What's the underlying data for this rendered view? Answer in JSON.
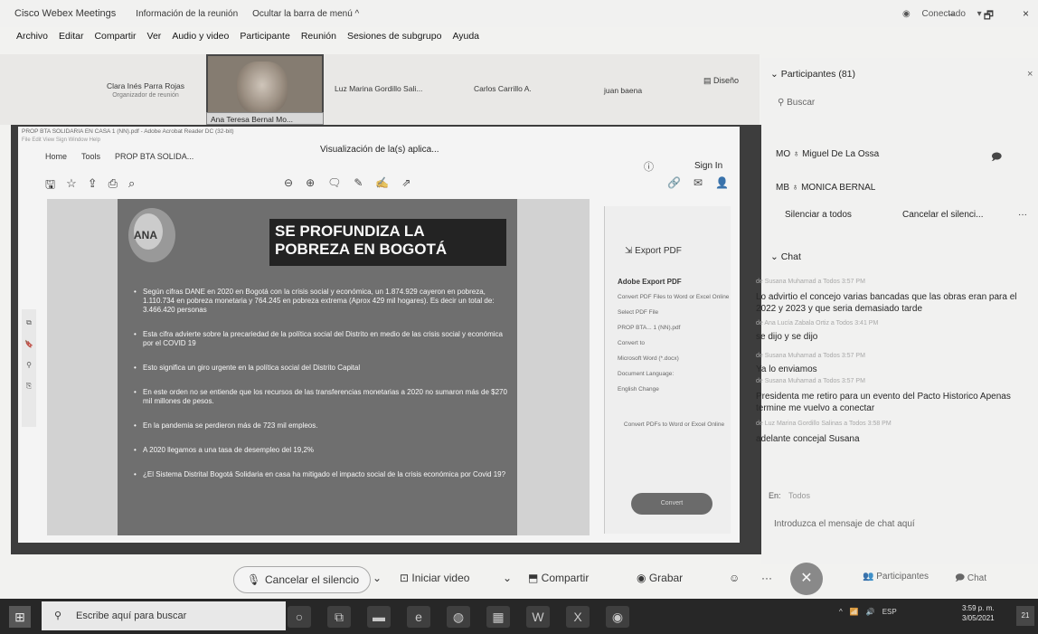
{
  "topbar": {
    "app_name": "Cisco Webex Meetings",
    "meeting_info": "Información de la reunión",
    "hide_menu": "Ocultar la barra de menú ^",
    "status": "Conectado",
    "status_caret": "▾",
    "minimize": "–",
    "restore": "🗗",
    "close": "×"
  },
  "menu": [
    "Archivo",
    "Editar",
    "Compartir",
    "Ver",
    "Audio y video",
    "Participante",
    "Reunión",
    "Sesiones de subgrupo",
    "Ayuda"
  ],
  "strip": {
    "p1_name": "Clara Inés Parra Rojas",
    "p1_role": "Organizador de reunión",
    "video_name": "Ana Teresa Bernal Mo...",
    "p3_name": "Luz Marina Gordillo Sali...",
    "p4_name": "Carlos Carrillo A.",
    "p5_name": "juan baena",
    "layout_label": "Diseño"
  },
  "share": {
    "window_title": "PROP BTA SOLIDARIA EN CASA 1 (NN).pdf - Adobe Acrobat Reader DC (32-bit)",
    "app_menu": "File Edit View Sign Window Help",
    "tab_home": "Home",
    "tab_tools": "Tools",
    "tab_doc": "PROP BTA SOLIDA...",
    "viewing_label": "Visualización de la(s) aplica...",
    "signin": "Sign In",
    "slide_title": "SE PROFUNDIZA LA POBREZA EN BOGOTÁ",
    "logo_text": "ANA",
    "bullets": [
      "Según cifras DANE en 2020 en Bogotá con la crisis social y económica, un 1.874.929 cayeron en pobreza, 1.110.734 en pobreza monetaria y 764.245 en pobreza extrema (Aprox 429 mil hogares). Es decir un total de: 3.466.420 personas",
      "Esta cifra advierte sobre la precariedad de la política social del Distrito en medio de las crisis social y económica por el COVID 19",
      "Esto significa un giro urgente en la política social del Distrito Capital",
      "En este orden no se entiende que los recursos de las transferencias monetarias a 2020 no sumaron más de $270 mil millones de pesos.",
      "En la pandemia se perdieron más de 723 mil empleos.",
      "A 2020 llegamos a una tasa de desempleo del 19,2%",
      "¿El Sistema Distrital Bogotá Solidaria en casa ha mitigado el impacto social de la crisis económica por Covid 19?"
    ],
    "export_header": "Export PDF",
    "export_sub": "Adobe Export PDF",
    "export_desc": "Convert PDF Files to Word or Excel Online",
    "select_label": "Select PDF File",
    "file_name": "PROP BTA... 1 (NN).pdf",
    "convert_to": "Convert to",
    "format": "Microsoft Word (*.docx)",
    "doc_lang": "Document Language:",
    "lang_value": "English Change",
    "convert_desc": "Convert PDFs to Word or Excel Online",
    "convert_btn": "Convert"
  },
  "participants": {
    "header": "Participantes (81)",
    "search_placeholder": "Buscar",
    "p1_initials": "MO",
    "p1_name": "Miguel De La Ossa",
    "p2_initials": "MB",
    "p2_name": "MONICA BERNAL",
    "silence_all": "Silenciar a todos",
    "cancel_silence": "Cancelar el silenci...",
    "more": "···",
    "close": "×"
  },
  "chat": {
    "header": "Chat",
    "messages": [
      {
        "meta": "de Susana Muhamad a Todos   3:57 PM",
        "text": "Lo advirtio el concejo varias bancadas que las obras eran para el 2022 y 2023 y que seria demasiado tarde"
      },
      {
        "meta": "de Ana Lucía Zabala Ortiz a Todos   3:41 PM",
        "text": "se dijo y se dijo"
      },
      {
        "meta": "de Susana Muhamad a Todos   3:57 PM",
        "text": "Ya lo enviamos"
      },
      {
        "meta": "de Susana Muhamad a Todos   3:57 PM",
        "text": "Presidenta me retiro para un evento del Pacto Historico Apenas termine me vuelvo a conectar"
      },
      {
        "meta": "de Luz Marina Gordillo Salinas a Todos   3:58 PM",
        "text": "adelante concejal Susana"
      }
    ],
    "to_label": "En:",
    "to_value": "Todos",
    "input_placeholder": "Introduzca el mensaje de chat aquí"
  },
  "controls": {
    "mute": "Cancelar el silencio",
    "video": "Iniciar video",
    "share": "Compartir",
    "record": "Grabar",
    "more": "···",
    "participants": "Participantes",
    "chat": "Chat"
  },
  "taskbar": {
    "search_placeholder": "Escribe aquí para buscar",
    "time": "3:59 p. m.",
    "date": "3/05/2021",
    "lang": "ESP",
    "notif": "21"
  }
}
